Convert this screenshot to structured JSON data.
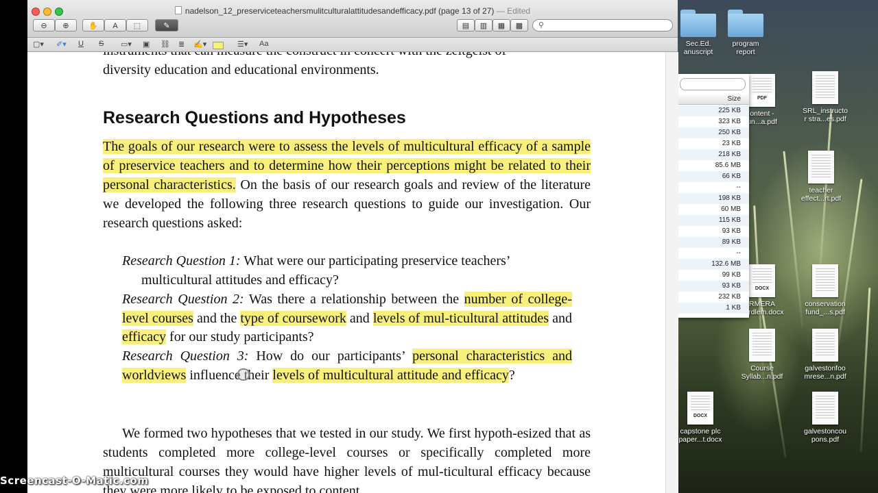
{
  "window": {
    "title": "nadelson_12_preserviceteachersmulitculturalattitudesandefficacy.pdf (page 13 of 27)",
    "edited": "— Edited"
  },
  "colors": {
    "highlight": "#f8ef7c",
    "accent_dark": "#474747"
  },
  "document": {
    "top_line_1": "instruments that can measure the construct in concert with the zeitgeist of",
    "top_line_2": "diversity education and educational environments.",
    "heading": "Research Questions and Hypotheses",
    "para1_highlight": "The goals of our research were to assess the levels of multicultural efficacy of a sample of preservice teachers and to determine how their perceptions might be related to their personal characteristics.",
    "para1_rest": " On the basis of our research goals and review of the literature we developed the following three research questions to guide our investigation. Our research questions asked:",
    "rq1_label": "Research Question 1:",
    "rq1_text": " What were our participating preservice teachers’",
    "rq1_text2": "multicultural attitudes and efficacy?",
    "rq2_label": "Research Question 2:",
    "rq2_a": " Was there a relationship between the ",
    "rq2_h1": "number of college-level courses",
    "rq2_b": " and the ",
    "rq2_h2": "type of coursework",
    "rq2_c": " and ",
    "rq2_h3": "levels of mul-ticultural attitudes",
    "rq2_d": " and ",
    "rq2_h4": "efficacy",
    "rq2_e": " for our study participants?",
    "rq3_label": "Research Question 3:",
    "rq3_a": " How do our participants’ ",
    "rq3_h1": "personal characteristics and worldviews",
    "rq3_b": " influence their ",
    "rq3_h2": "levels of multicultural attitude and efficacy",
    "rq3_c": "?",
    "para2": "We formed two hypotheses that we tested in our study. We first hypoth-esized that as students completed more college-level courses or specifically completed more multicultural courses they would have higher levels of mul-ticultural efficacy because they were more likely to be exposed to content"
  },
  "finder": {
    "size_header": "Size",
    "sizes": [
      "225 KB",
      "323 KB",
      "250 KB",
      "23 KB",
      "218 KB",
      "85.6 MB",
      "66 KB",
      "--",
      "198 KB",
      "60 MB",
      "115 KB",
      "93 KB",
      "89 KB",
      "--",
      "132.6 MB",
      "99 KB",
      "93 KB",
      "232 KB",
      "1 KB"
    ]
  },
  "desktop_icons": [
    {
      "label": "Sec.Ed.\nanuscript",
      "kind": "folder"
    },
    {
      "label": "program\nreport",
      "kind": "folder"
    },
    {
      "label": "ontent -\nun...a.pdf",
      "kind": "doc",
      "tag": "PDF"
    },
    {
      "label": "SRL_instructo\nr stra...es.pdf",
      "kind": "doc"
    },
    {
      "label": "teacher\neffect...rt.pdf",
      "kind": "doc"
    },
    {
      "label": "RMERA\nperdlem.docx",
      "kind": "doc",
      "tag": "DOCX"
    },
    {
      "label": "conservation\nfund_...s.pdf",
      "kind": "doc"
    },
    {
      "label": "Course\nSyllab...n.pdf",
      "kind": "doc"
    },
    {
      "label": "galvestonfoo\nmrese...n.pdf",
      "kind": "doc"
    },
    {
      "label": "capstone plc\npaper...t.docx",
      "kind": "doc",
      "tag": "DOCX"
    },
    {
      "label": "galvestoncou\npons.pdf",
      "kind": "doc"
    }
  ],
  "watermark": "Screencast-O-Matic.com"
}
